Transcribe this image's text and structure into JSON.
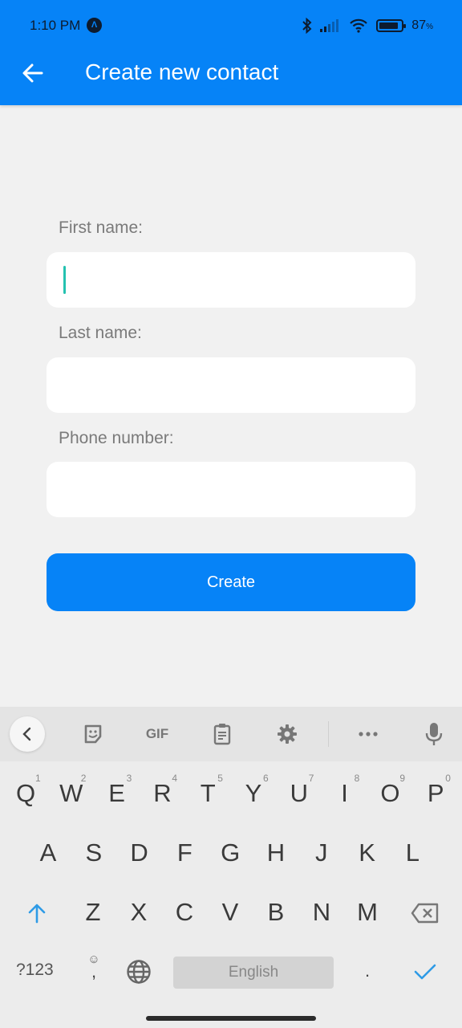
{
  "status_bar": {
    "time": "1:10 PM",
    "nav_badge": "Λ",
    "battery_percent": "87",
    "battery_suffix": "%",
    "battery_level": 0.87
  },
  "app_bar": {
    "title": "Create new contact",
    "back_icon": "arrow-left-icon"
  },
  "form": {
    "fields": [
      {
        "label": "First name:",
        "value": "",
        "focused": true
      },
      {
        "label": "Last name:",
        "value": ""
      },
      {
        "label": "Phone number:",
        "value": ""
      }
    ],
    "submit_label": "Create"
  },
  "keyboard": {
    "toolbar": [
      "collapse-icon",
      "sticker-icon",
      "GIF",
      "clipboard-icon",
      "settings-icon",
      "more-icon",
      "mic-icon"
    ],
    "gif_label": "GIF",
    "row1": [
      {
        "key": "Q",
        "hint": "1"
      },
      {
        "key": "W",
        "hint": "2"
      },
      {
        "key": "E",
        "hint": "3"
      },
      {
        "key": "R",
        "hint": "4"
      },
      {
        "key": "T",
        "hint": "5"
      },
      {
        "key": "Y",
        "hint": "6"
      },
      {
        "key": "U",
        "hint": "7"
      },
      {
        "key": "I",
        "hint": "8"
      },
      {
        "key": "O",
        "hint": "9"
      },
      {
        "key": "P",
        "hint": "0"
      }
    ],
    "row2": [
      "A",
      "S",
      "D",
      "F",
      "G",
      "H",
      "J",
      "K",
      "L"
    ],
    "row3": [
      "Z",
      "X",
      "C",
      "V",
      "B",
      "N",
      "M"
    ],
    "symbols_label": "?123",
    "comma": ",",
    "space_label": "English",
    "period": ".",
    "accent_color": "#2e9be6"
  },
  "colors": {
    "primary": "#0683f7",
    "background": "#f1f1f1",
    "caret": "#24c2b0"
  }
}
